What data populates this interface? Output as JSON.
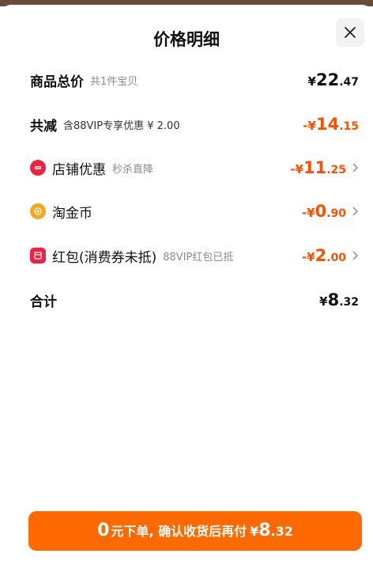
{
  "header": {
    "title": "价格明细"
  },
  "rows": {
    "subtotal": {
      "label": "商品总价",
      "sub": "共1件宝贝",
      "currency": "¥",
      "int": "22",
      "dec": ".47"
    },
    "discount": {
      "label": "共减",
      "sub": "含88VIP专享优惠 ¥ 2.00",
      "currency": "-¥",
      "int": "14",
      "dec": ".15"
    },
    "store": {
      "label": "店铺优惠",
      "sub": "秒杀直降",
      "currency": "-¥",
      "int": "11",
      "dec": ".25"
    },
    "coin": {
      "label": "淘金币",
      "currency": "-¥",
      "int": "0",
      "dec": ".90"
    },
    "redpacket": {
      "label": "红包(消费券未抵)",
      "sub": "88VIP红包已抵",
      "currency": "-¥",
      "int": "2",
      "dec": ".00"
    },
    "total": {
      "label": "合计",
      "currency": "¥",
      "int": "8",
      "dec": ".32"
    }
  },
  "pay_button": {
    "zero": "0",
    "text": "元下单, 确认收货后再付",
    "currency": "¥",
    "int": "8",
    "dec": ".32"
  },
  "colors": {
    "accent": "#ff5000",
    "button": "#ff6a00",
    "icon_red": "#f0233f",
    "icon_gold": "#f5a623"
  },
  "icons": {
    "close": "close-icon",
    "store": "store-icon",
    "coin": "coin-icon",
    "redpacket": "red-packet-icon",
    "chevron": "chevron-right-icon"
  }
}
